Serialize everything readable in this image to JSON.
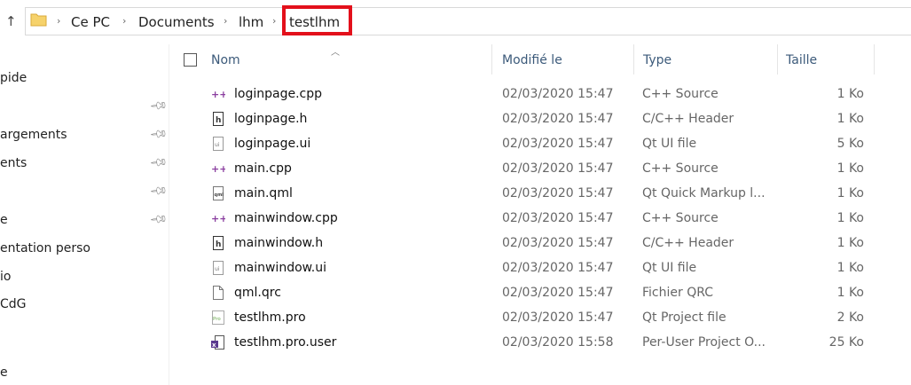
{
  "breadcrumb": {
    "items": [
      "Ce PC",
      "Documents",
      "lhm",
      "testlhm"
    ],
    "separator": "›"
  },
  "sidebar": {
    "items": [
      "pide",
      "argements",
      "ents",
      "e",
      "entation perso",
      "io",
      "CdG",
      "e"
    ]
  },
  "columns": {
    "name": "Nom",
    "modified": "Modifié le",
    "type": "Type",
    "size": "Taille"
  },
  "files": [
    {
      "name": "loginpage.cpp",
      "modified": "02/03/2020 15:47",
      "type": "C++ Source",
      "size": "1 Ko",
      "icon": "cpp-icon"
    },
    {
      "name": "loginpage.h",
      "modified": "02/03/2020 15:47",
      "type": "C/C++ Header",
      "size": "1 Ko",
      "icon": "header-icon"
    },
    {
      "name": "loginpage.ui",
      "modified": "02/03/2020 15:47",
      "type": "Qt UI file",
      "size": "5 Ko",
      "icon": "ui-icon"
    },
    {
      "name": "main.cpp",
      "modified": "02/03/2020 15:47",
      "type": "C++ Source",
      "size": "1 Ko",
      "icon": "cpp-icon"
    },
    {
      "name": "main.qml",
      "modified": "02/03/2020 15:47",
      "type": "Qt Quick Markup l...",
      "size": "1 Ko",
      "icon": "qml-icon"
    },
    {
      "name": "mainwindow.cpp",
      "modified": "02/03/2020 15:47",
      "type": "C++ Source",
      "size": "1 Ko",
      "icon": "cpp-icon"
    },
    {
      "name": "mainwindow.h",
      "modified": "02/03/2020 15:47",
      "type": "C/C++ Header",
      "size": "1 Ko",
      "icon": "header-icon"
    },
    {
      "name": "mainwindow.ui",
      "modified": "02/03/2020 15:47",
      "type": "Qt UI file",
      "size": "1 Ko",
      "icon": "ui-icon"
    },
    {
      "name": "qml.qrc",
      "modified": "02/03/2020 15:47",
      "type": "Fichier QRC",
      "size": "1 Ko",
      "icon": "file-icon"
    },
    {
      "name": "testlhm.pro",
      "modified": "02/03/2020 15:47",
      "type": "Qt Project file",
      "size": "2 Ko",
      "icon": "pro-icon"
    },
    {
      "name": "testlhm.pro.user",
      "modified": "02/03/2020 15:58",
      "type": "Per-User Project O...",
      "size": "25 Ko",
      "icon": "user-project-icon"
    }
  ],
  "colors": {
    "highlight_box": "#e3101b",
    "cpp_icon": "#8b3fa0",
    "header_text": "#3c5a7a"
  }
}
